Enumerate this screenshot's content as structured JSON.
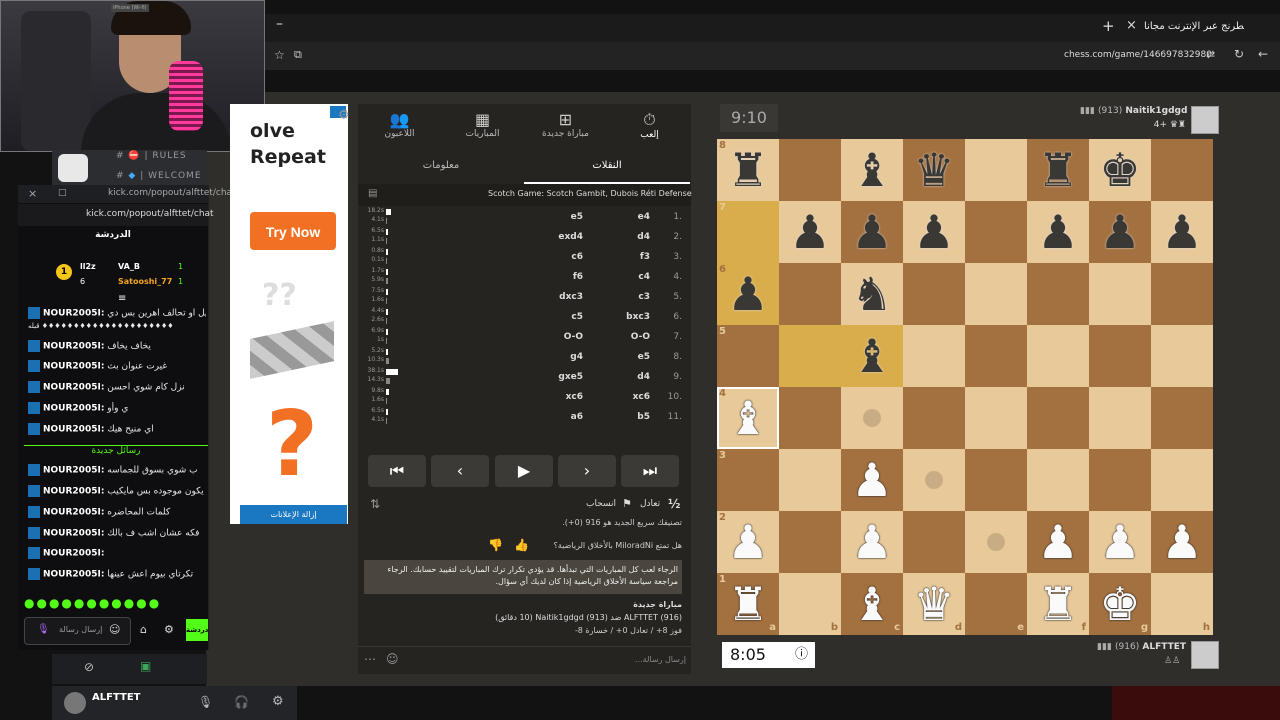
{
  "browser": {
    "tab_title": "إلعب الشطرنج عبر الإنترنت مجاناً",
    "url": "chess.com/game/146697832980"
  },
  "webcam": {
    "label": "iPhone (Wi-fi)"
  },
  "discord": {
    "ch1": "RULES",
    "ch2": "WELCOME",
    "user": "ALFTTET"
  },
  "kick": {
    "url": "kick.com/popout/alfttet/chat",
    "window_title": "kick.com/popout/alfttet/cha",
    "title": "الدردشة",
    "leaders": [
      {
        "name": "VA_B",
        "count": "1",
        "rank": "1",
        "other": "ll2z"
      },
      {
        "name": "Satooshi_77",
        "count": "1",
        "rank": "6"
      }
    ],
    "messages": [
      {
        "user": "NOUR2005I:",
        "text": "لا لا مستحيل او تحالف اهرين بس دي"
      },
      {
        "user": "",
        "text": "قبله ♦♦♦♦♦♦♦♦♦♦♦♦♦♦♦♦♦♦♦♦♦"
      },
      {
        "user": "NOUR2005I:",
        "text": "يخاف يخاف"
      },
      {
        "user": "NOUR2005I:",
        "text": "غيرت عنوان بث"
      },
      {
        "user": "NOUR2005I:",
        "text": "نزل كام شوي احسن"
      },
      {
        "user": "NOUR2005I:",
        "text": "ي وأو"
      },
      {
        "user": "NOUR2005I:",
        "text": "اي منيح هيك"
      }
    ],
    "new_label": "رسائل جديدة",
    "new_messages": [
      {
        "user": "NOUR2005I:",
        "text": "ب شوي بسوق للجماسه"
      },
      {
        "user": "NOUR2005I:",
        "text": "يكون موجوده بس مايكيب"
      },
      {
        "user": "NOUR2005I:",
        "text": "كلمات المحاضره"
      },
      {
        "user": "NOUR2005I:",
        "text": "فكه عشان اشب ف بالك"
      },
      {
        "user": "NOUR2005I:",
        "text": ""
      },
      {
        "user": "NOUR2005I:",
        "text": "تكرتاي بيوم اعش عينها"
      }
    ],
    "send_placeholder": "إرسال رسالة",
    "send_btn": "دردشة"
  },
  "ad": {
    "headline1": "olve",
    "headline2": "Repeat",
    "cta": "Try Now",
    "remove": "إزالة الإعلانات",
    "qmark": "?"
  },
  "panel": {
    "tabs": [
      "إلعب",
      "مباراة جديدة",
      "المباريات",
      "اللاعبون"
    ],
    "subtabs": [
      "النقلات",
      "معلومات"
    ],
    "opening": "Scotch Game: Scotch Gambit, Dubois Réti Defense",
    "moves": [
      {
        "n": "1.",
        "w": "e4",
        "b": "e5",
        "tw": "18.2s",
        "tb": "4.1s",
        "fw": 0.45,
        "fb": 0.1
      },
      {
        "n": "2.",
        "w": "d4",
        "b": "exd4",
        "tw": "6.5s",
        "tb": "1.1s",
        "fw": 0.17,
        "fb": 0.03
      },
      {
        "n": "3.",
        "w": "f3",
        "b": "c6",
        "tw": "0.8s",
        "tb": "0.1s",
        "fw": 0.02,
        "fb": 0.01
      },
      {
        "n": "4.",
        "w": "c4",
        "b": "f6",
        "tw": "1.7s",
        "tb": "5.9s",
        "fw": 0.04,
        "fb": 0.15
      },
      {
        "n": "5.",
        "w": "c3",
        "b": "dxc3",
        "tw": "7.5s",
        "tb": "1.6s",
        "fw": 0.2,
        "fb": 0.04
      },
      {
        "n": "6.",
        "w": "bxc3",
        "b": "c5",
        "tw": "4.4s",
        "tb": "2.6s",
        "fw": 0.11,
        "fb": 0.07
      },
      {
        "n": "7.",
        "w": "O-O",
        "b": "O-O",
        "tw": "6.9s",
        "tb": "1s",
        "fw": 0.18,
        "fb": 0.03
      },
      {
        "n": "8.",
        "w": "e5",
        "b": "g4",
        "tw": "5.2s",
        "tb": "10.3s",
        "fw": 0.13,
        "fb": 0.27
      },
      {
        "n": "9.",
        "w": "d4",
        "b": "gxe5",
        "tw": "38.1s",
        "tb": "14.3s",
        "fw": 1.0,
        "fb": 0.37
      },
      {
        "n": "10.",
        "w": "xc6",
        "b": "xc6",
        "tw": "9.8s",
        "tb": "1.6s",
        "fw": 0.26,
        "fb": 0.04
      },
      {
        "n": "11.",
        "w": "b5",
        "b": "a6",
        "tw": "6.5s",
        "tb": "4.1s",
        "fw": 0.17,
        "fb": 0.1
      }
    ],
    "draw": "تعادل",
    "resign": "انسحاب",
    "half": "½",
    "rating_msg": "تصنيفك سريع الجديد هو 916 (0+).",
    "sportsmanship": "هل تمتع MiloradNi بالأخلاق الرياضية؟",
    "notice": "الرجاء لعب كل المباريات التي تبدأها. قد يؤدي تكرار ترك المباريات لتقييد حسابك. الرجاء مراجعة سياسة الأخلاق الرياضية إذا كان لديك أي سؤال.",
    "new_game_title": "مباراة جديدة",
    "new_game_line": "ALFTTET (916) ضد Naitik1gdgd (913) (10 دقائق)",
    "record": "فوز 8+ / تعادل 0+ / خسارة 8-",
    "chat_placeholder": "إرسال رسالة..."
  },
  "game": {
    "clock_top": "9:10",
    "clock_bottom": "8:05",
    "top_player": "Naitik1gdgd",
    "top_rating": "(913)",
    "top_extra": "4+",
    "bottom_player": "ALFTTET",
    "bottom_rating": "(916)",
    "ranks": [
      "8",
      "7",
      "6",
      "5",
      "4",
      "3",
      "2",
      "1"
    ],
    "files": [
      "a",
      "b",
      "c",
      "d",
      "e",
      "f",
      "g",
      "h"
    ],
    "board": [
      [
        "br",
        "",
        "bb",
        "bq",
        "",
        "br",
        "bk",
        ""
      ],
      [
        "",
        "bp",
        "bp",
        "bp",
        "",
        "bp",
        "bp",
        "bp"
      ],
      [
        "bp",
        "",
        "bn",
        "",
        "",
        "",
        "",
        ""
      ],
      [
        "",
        "",
        "bb",
        "",
        "",
        "",
        "",
        ""
      ],
      [
        "wb",
        "",
        "",
        "",
        "",
        "",
        "",
        ""
      ],
      [
        "",
        "",
        "wp",
        "",
        "",
        "",
        "",
        ""
      ],
      [
        "wp",
        "",
        "wp",
        "",
        "",
        "wp",
        "wp",
        "wp"
      ],
      [
        "wr",
        "",
        "wb",
        "wq",
        "",
        "wr",
        "wk",
        ""
      ]
    ]
  }
}
